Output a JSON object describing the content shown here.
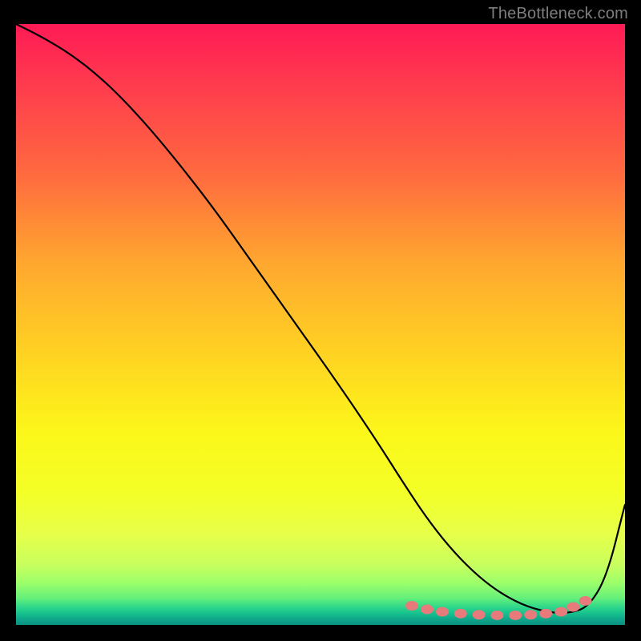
{
  "watermark": "TheBottleneck.com",
  "chart_data": {
    "type": "line",
    "title": "",
    "xlabel": "",
    "ylabel": "",
    "xlim": [
      0,
      100
    ],
    "ylim": [
      0,
      100
    ],
    "series": [
      {
        "name": "bottleneck-curve",
        "x": [
          0,
          4,
          9,
          14,
          19,
          25,
          32,
          39,
          46,
          53,
          59,
          64,
          68,
          72,
          76,
          80,
          84,
          88,
          91,
          94,
          97,
          100
        ],
        "y": [
          100,
          98,
          95,
          91,
          86,
          79,
          70,
          60,
          50,
          40,
          31,
          23,
          17,
          12,
          8,
          5,
          3,
          2,
          2,
          3,
          8,
          20
        ]
      }
    ],
    "markers": {
      "name": "highlight-dots",
      "x": [
        65,
        67.5,
        70,
        73,
        76,
        79,
        82,
        84.5,
        87,
        89.5,
        91.5,
        93.5
      ],
      "y": [
        3.2,
        2.6,
        2.2,
        1.9,
        1.7,
        1.6,
        1.6,
        1.7,
        1.9,
        2.2,
        3.0,
        4.0
      ]
    },
    "background_gradient": {
      "top": "#ff1a55",
      "mid": "#fcf71a",
      "bottom": "#0a8f82"
    }
  }
}
